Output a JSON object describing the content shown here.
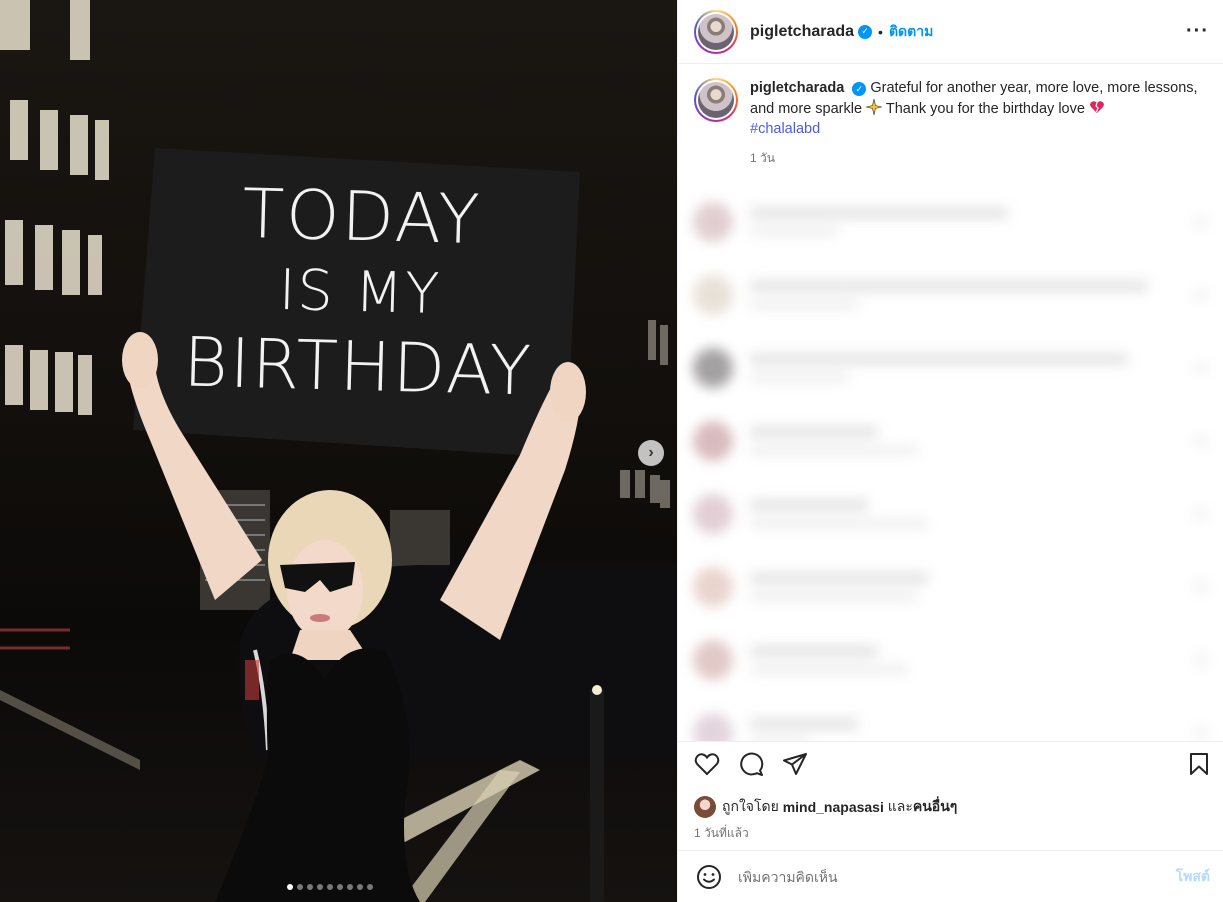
{
  "post": {
    "username": "pigletcharada",
    "follow_label": "ติดตาม",
    "bullet": "•",
    "more_icon": "more-horizontal-icon"
  },
  "photo": {
    "sign_line1": "TODAY",
    "sign_line2": "IS MY",
    "sign_line3": "BIRTHDAY",
    "carousel_total": 9,
    "carousel_active": 1
  },
  "caption": {
    "username": "pigletcharada",
    "text_part1": "Grateful for another year, more love, more lessons, and more sparkle",
    "text_part2": "Thank you for the birthday love",
    "hashtag": "#chalalabd",
    "time": "1 วัน"
  },
  "likes": {
    "prefix": "ถูกใจโดย",
    "user": "mind_napasasi",
    "connector": "และ",
    "others": "คนอื่นๆ"
  },
  "post_time": "1 วันที่แล้ว",
  "comment_box": {
    "placeholder": "เพิ่มความคิดเห็น",
    "post_label": "โพสต์"
  },
  "colors": {
    "accent": "#0095f6",
    "hashtag": "#4d5ae8",
    "post_disabled": "#b3dbff"
  }
}
